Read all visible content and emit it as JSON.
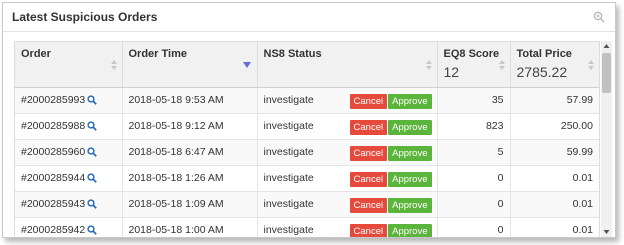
{
  "panel": {
    "title": "Latest Suspicious Orders",
    "icons": {
      "header": "zoom-icon",
      "order_link": "search-icon"
    }
  },
  "table": {
    "columns": [
      {
        "label": "Order",
        "summary": ""
      },
      {
        "label": "Order Time",
        "summary": "",
        "sorted": "desc"
      },
      {
        "label": "NS8 Status",
        "summary": ""
      },
      {
        "label": "EQ8 Score",
        "summary": "12"
      },
      {
        "label": "Total Price",
        "summary": "2785.22"
      }
    ],
    "rows": [
      {
        "order": "#2000285993",
        "time": "2018-05-18 9:53 AM",
        "status": "investigate",
        "score": "35",
        "price": "57.99"
      },
      {
        "order": "#2000285988",
        "time": "2018-05-18 9:12 AM",
        "status": "investigate",
        "score": "823",
        "price": "250.00"
      },
      {
        "order": "#2000285960",
        "time": "2018-05-18 6:47 AM",
        "status": "investigate",
        "score": "5",
        "price": "59.99"
      },
      {
        "order": "#2000285944",
        "time": "2018-05-18 1:26 AM",
        "status": "investigate",
        "score": "0",
        "price": "0.01"
      },
      {
        "order": "#2000285943",
        "time": "2018-05-18 1:09 AM",
        "status": "investigate",
        "score": "0",
        "price": "0.01"
      },
      {
        "order": "#2000285942",
        "time": "2018-05-18 1:00 AM",
        "status": "investigate",
        "score": "0",
        "price": "0.01"
      }
    ],
    "actions": {
      "cancel": "Cancel",
      "approve": "Approve"
    }
  },
  "colors": {
    "cancel": "#e64a3c",
    "approve": "#5bb43c",
    "link": "#2a6ebb",
    "sort_active": "#6b6bd6"
  }
}
